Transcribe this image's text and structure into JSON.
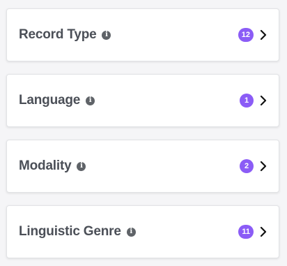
{
  "filters": [
    {
      "label": "Record Type",
      "count": "12"
    },
    {
      "label": "Language",
      "count": "1"
    },
    {
      "label": "Modality",
      "count": "2"
    },
    {
      "label": "Linguistic Genre",
      "count": "11"
    }
  ],
  "colors": {
    "badge": "#8b5cf6",
    "label": "#4b4f57",
    "card_border": "#e2e3e6",
    "background": "#f5f5f7"
  },
  "icons": {
    "info": "info-icon",
    "expand": "chevron-right-icon",
    "info_glyph": "i"
  }
}
